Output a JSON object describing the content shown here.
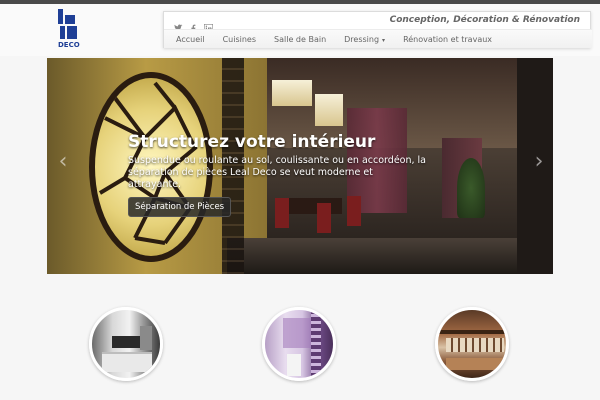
{
  "brand": {
    "logo_text": "DECO",
    "color": "#1f3f96"
  },
  "header": {
    "tagline": "Conception, Décoration & Rénovation",
    "social": [
      "twitter-icon",
      "facebook-icon",
      "linkedin-icon"
    ]
  },
  "nav": {
    "items": [
      {
        "label": "Accueil"
      },
      {
        "label": "Cuisines"
      },
      {
        "label": "Salle de Bain"
      },
      {
        "label": "Dressing",
        "caret": "▾"
      },
      {
        "label": "Rénovation et travaux"
      }
    ]
  },
  "slider": {
    "title": "Structurez votre intérieur",
    "text": "Suspendue ou roulante au sol, coulissante ou en accordéon, la séparation de pièces Leal Deco se veut moderne et attrayante.",
    "button": "Séparation de Pièces",
    "prev": "‹",
    "next": "›"
  },
  "thumbnails": [
    {
      "name": "kitchen"
    },
    {
      "name": "bathroom"
    },
    {
      "name": "dressing"
    }
  ]
}
